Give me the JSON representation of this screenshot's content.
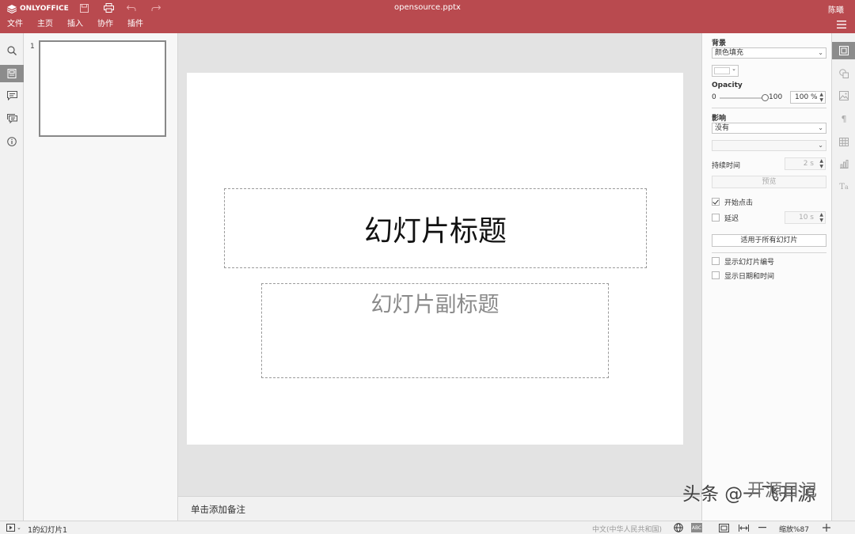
{
  "app": {
    "brand": "ONLYOFFICE",
    "file_name": "opensource.pptx",
    "user": "陈曦"
  },
  "menu": [
    "文件",
    "主页",
    "插入",
    "协作",
    "插件"
  ],
  "thumbnails": [
    {
      "number": "1"
    }
  ],
  "slide": {
    "title": "幻灯片标题",
    "subtitle": "幻灯片副标题"
  },
  "notes": {
    "placeholder": "单击添加备注"
  },
  "panel": {
    "background_label": "背景",
    "fill_type": "颜色填充",
    "opacity_label": "Opacity",
    "opacity_min": "0",
    "opacity_max": "100",
    "opacity_value": "100 %",
    "opacity_level": 1.0,
    "effect_label": "影响",
    "effect_value": "没有",
    "effect_sub_value": "",
    "duration_label": "持续时间",
    "duration_value": "2 s",
    "preview_button": "预览",
    "start_on_click_label": "开始点击",
    "start_on_click_checked": true,
    "delay_label": "延迟",
    "delay_checked": false,
    "delay_value": "10 s",
    "apply_all_button": "适用于所有幻灯片",
    "show_slide_number_label": "显示幻灯片编号",
    "show_date_time_label": "显示日期和时间"
  },
  "status": {
    "slide_info": "1的幻灯片1",
    "language": "中文(中华人民共和国)",
    "zoom": "缩放%87"
  },
  "watermark": {
    "line1": "头条 @一飞开源",
    "line2": "开源日记"
  },
  "colors": {
    "header": "#b94a4f",
    "active_tool": "#8c8c8c"
  }
}
